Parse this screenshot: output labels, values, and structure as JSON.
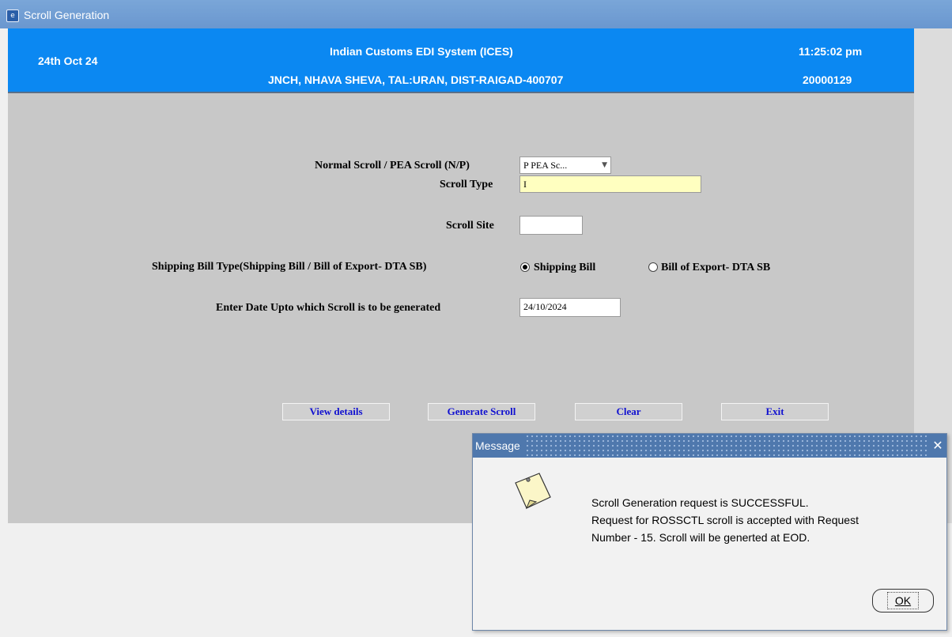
{
  "window": {
    "title": "Scroll Generation"
  },
  "header": {
    "date": "24th Oct 24",
    "system_name": "Indian Customs EDI System (ICES)",
    "location": "JNCH, NHAVA SHEVA, TAL:URAN, DIST-RAIGAD-400707",
    "time": "11:25:02 pm",
    "user_id": "20000129"
  },
  "form": {
    "scroll_mode": {
      "label": "Normal Scroll / PEA Scroll (N/P)",
      "value": "P PEA Sc..."
    },
    "scroll_type": {
      "label": "Scroll Type",
      "value": "I"
    },
    "scroll_site": {
      "label": "Scroll Site",
      "value": ""
    },
    "sb_type": {
      "label": "Shipping Bill Type(Shipping Bill  / Bill of Export- DTA SB)",
      "options": [
        "Shipping Bill",
        "Bill of Export- DTA SB"
      ],
      "selected": "Shipping Bill"
    },
    "date_upto": {
      "label": "Enter Date Upto which Scroll is to be generated",
      "value": "24/10/2024"
    }
  },
  "buttons": {
    "view_details": "View details",
    "generate_scroll": "Generate Scroll",
    "clear": "Clear",
    "exit": "Exit"
  },
  "dialog": {
    "title": "Message",
    "lines": [
      "Scroll Generation request is SUCCESSFUL.",
      "Request for ROSSCTL scroll is accepted with Request",
      "Number - 15. Scroll will be generted at EOD."
    ],
    "ok_label": "OK",
    "icon": "note-icon",
    "close_icon": "close-icon"
  },
  "colors": {
    "header_bg": "#0b88f2",
    "titlebar_bg": "#6a97cf",
    "form_bg": "#c8c8c8",
    "button_text": "#1010d0",
    "yellow_field": "#ffffc0"
  }
}
